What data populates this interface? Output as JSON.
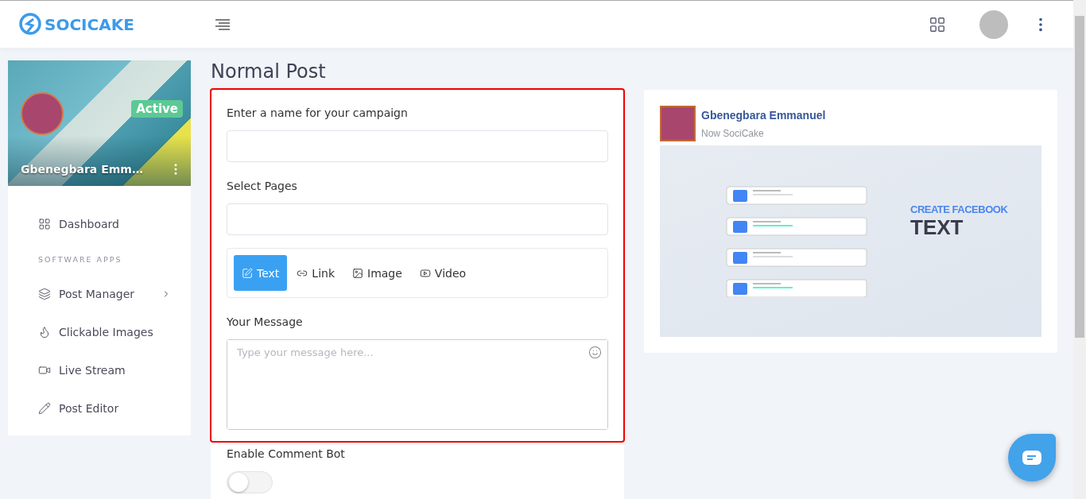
{
  "brand": {
    "name": "SOCICAKE"
  },
  "profile": {
    "name": "Gbenegbara Emm…",
    "status": "Active"
  },
  "sidebar": {
    "items": [
      {
        "kind": "link",
        "label": "Dashboard"
      },
      {
        "kind": "heading",
        "label": "SOFTWARE APPS"
      },
      {
        "kind": "submenu",
        "label": "Post Manager",
        "expanded": false
      },
      {
        "kind": "link",
        "label": "Clickable Images"
      },
      {
        "kind": "link",
        "label": "Live Stream"
      },
      {
        "kind": "link",
        "label": "Post Editor"
      }
    ]
  },
  "page": {
    "title": "Normal Post"
  },
  "form": {
    "campaign_label": "Enter a name for your campaign",
    "pages_label": "Select Pages",
    "post_types": [
      {
        "label": "Text",
        "selected": true
      },
      {
        "label": "Link",
        "selected": false
      },
      {
        "label": "Image",
        "selected": false
      },
      {
        "label": "Video",
        "selected": false
      }
    ],
    "message_label": "Your Message",
    "message_placeholder": "Type your message here...",
    "comment_bot": {
      "label": "Enable Comment Bot",
      "on": false
    }
  },
  "preview": {
    "author": "Gbenegbara Emmanuel",
    "subtitle": "Now SociCake",
    "image_heading": "CREATE FACEBOOK",
    "image_title": "TEXT"
  }
}
